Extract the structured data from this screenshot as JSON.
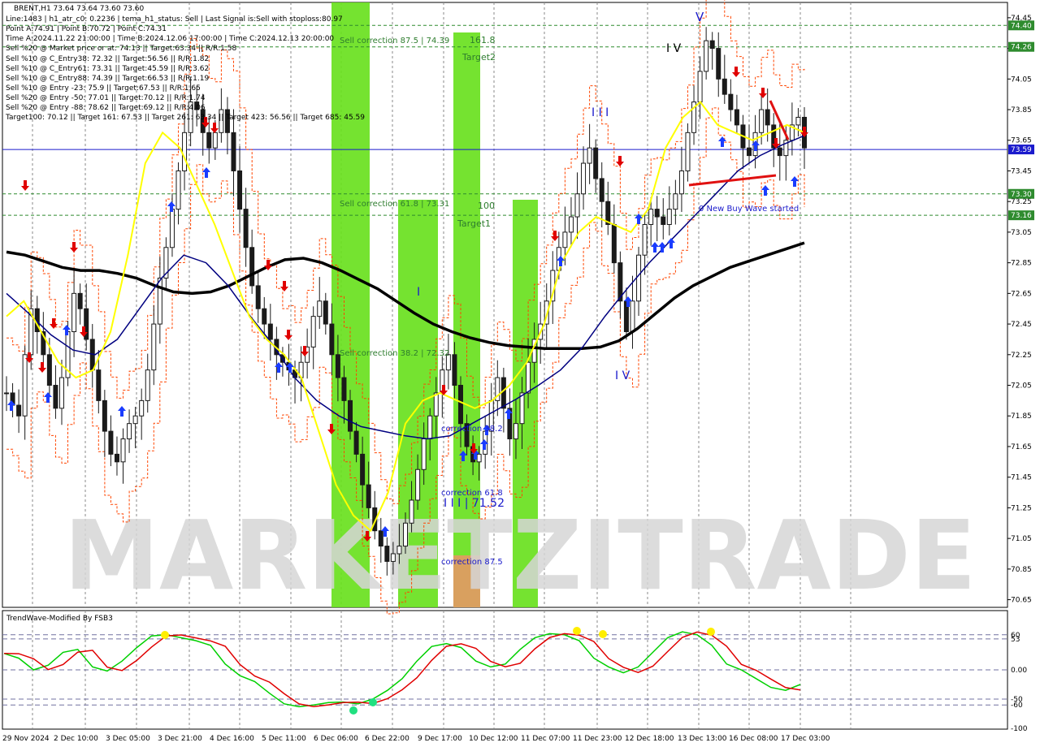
{
  "header": {
    "info_lines": [
      "BRENT,H1  73.64 73.64 73.60 73.60",
      "Line:1483  | h1_atr_c0: 0.2236  | tema_h1_status: Sell  | Last Signal is:Sell with stoploss:80.97",
      "Point A:74.91  | Point B:70.72  | Point C:74.31",
      "Time A:2024.11.22 21:00:00  | Time B:2024.12.06 17:00:00  | Time C:2024.12.13 20:00:00",
      "Sell %20 @ Market price or at: 74.13  || Target:63.34  || R/R:1.58",
      "Sell %10 @ C_Entry38: 72.32  || Target:56.56  || R/R:1.82",
      "Sell %10 @ C_Entry61: 73.31  || Target:45.59  || R/R:3.62",
      "Sell %10 @ C_Entry88: 74.39  || Target:66.53  || R/R:1.19",
      "Sell %10 @ Entry -23: 75.9  || Target:67.53  || R/R:1.65",
      "Sell %20 @ Entry -50: 77.01  || Target:70.12  || R/R:1.74",
      "Sell %20 @ Entry -88: 78.62  || Target:69.12  || R/R:4.06",
      "Target100: 70.12  || Target 161: 67.53  || Target 261: 63.34  || Target 423: 56.56  || Target 685: 45.59"
    ]
  },
  "colors": {
    "background": "#ffffff",
    "grid": "#8a8a8a",
    "candle_up": "#1a1a1a",
    "candle_down": "#1a1a1a",
    "ma_slow": "#000000",
    "ma_mid": "#000080",
    "ma_fast": "#ffff00",
    "envelope": "#ff4500",
    "green_zone": "#66e01a",
    "green_zone_dark": "#22b91c",
    "orange_zone": "#d9a05f",
    "price_line": "#1a1acc",
    "level_line": "#2e8b2e",
    "up_arrow": "#1a3cff",
    "down_arrow": "#e00000",
    "osc_green": "#00d000",
    "osc_red": "#e00000",
    "osc_dot_yellow": "#ffee00",
    "osc_dot_green": "#20e080",
    "price_label_green": "#2e8b2e",
    "price_label_blue": "#1a1acc"
  },
  "annotations": {
    "sell_corr_875": "Sell correction 87.5 | 74.39",
    "sell_corr_618": "Sell correction 61.8 | 73.31",
    "sell_corr_382": "Sell correction 38.2 | 72.32",
    "ext_1618": "161.8",
    "target2": "Target2",
    "ext_100": "100",
    "target1": "Target1",
    "corr_382": "correction 38.2",
    "corr_618": "correction 61.8",
    "corr_875": "correction 87.5",
    "wave_III_val": "I I I | 71.52",
    "new_buy_wave": "0 New Buy Wave started",
    "wave_I": "I",
    "wave_III_top": "I I I",
    "wave_IV_top": "I V",
    "wave_V": "V",
    "wave_IV_bottom": "I V",
    "watermark": "MARKETZITRADE"
  },
  "price_labels": [
    {
      "text": "74.40",
      "kind": "level",
      "value": 74.4
    },
    {
      "text": "74.26",
      "kind": "level",
      "value": 74.26
    },
    {
      "text": "73.59",
      "kind": "current",
      "value": 73.59
    },
    {
      "text": "73.30",
      "kind": "level",
      "value": 73.3
    },
    {
      "text": "73.16",
      "kind": "level",
      "value": 73.16
    }
  ],
  "oscillator": {
    "title": "TrendWave-Modified By FSB3",
    "y_ticks": [
      "60",
      "53",
      "0.00",
      "-50",
      "-60",
      "-100"
    ]
  },
  "chart_data": {
    "type": "candlestick",
    "symbol": "BRENT,H1",
    "ylim": [
      70.6,
      74.55
    ],
    "y_ticks": [
      "74.45",
      "74.25",
      "74.05",
      "73.85",
      "73.65",
      "73.45",
      "73.25",
      "73.05",
      "72.85",
      "72.65",
      "72.45",
      "72.25",
      "72.05",
      "71.85",
      "71.65",
      "71.45",
      "71.25",
      "71.05",
      "70.85",
      "70.65"
    ],
    "x_ticks": [
      "29 Nov 2024",
      "2 Dec 10:00",
      "3 Dec 05:00",
      "3 Dec 21:00",
      "4 Dec 16:00",
      "5 Dec 11:00",
      "6 Dec 06:00",
      "6 Dec 22:00",
      "9 Dec 17:00",
      "10 Dec 12:00",
      "11 Dec 07:00",
      "11 Dec 23:00",
      "12 Dec 18:00",
      "13 Dec 13:00",
      "16 Dec 08:00",
      "17 Dec 03:00"
    ],
    "closes": [
      72.0,
      71.92,
      71.85,
      72.25,
      72.55,
      72.4,
      72.25,
      72.05,
      71.9,
      72.1,
      72.4,
      72.65,
      72.55,
      72.35,
      72.15,
      71.95,
      71.75,
      71.6,
      71.55,
      71.7,
      71.8,
      71.85,
      71.95,
      72.15,
      72.45,
      72.75,
      72.95,
      73.2,
      73.45,
      73.7,
      73.9,
      73.85,
      73.7,
      73.6,
      73.7,
      73.85,
      73.7,
      73.45,
      73.2,
      72.95,
      72.7,
      72.55,
      72.45,
      72.35,
      72.25,
      72.2,
      72.15,
      72.1,
      72.2,
      72.3,
      72.5,
      72.6,
      72.45,
      72.25,
      72.1,
      71.95,
      71.75,
      71.6,
      71.4,
      71.25,
      71.1,
      71.0,
      70.9,
      70.95,
      71.0,
      71.15,
      71.3,
      71.5,
      71.7,
      71.85,
      72.0,
      72.15,
      72.25,
      72.05,
      71.8,
      71.65,
      71.55,
      71.6,
      71.75,
      71.95,
      72.1,
      71.9,
      71.7,
      71.8,
      72.0,
      72.2,
      72.35,
      72.45,
      72.6,
      72.8,
      72.95,
      73.05,
      73.15,
      73.3,
      73.5,
      73.6,
      73.4,
      73.25,
      73.1,
      72.85,
      72.6,
      72.4,
      72.6,
      72.9,
      73.1,
      73.2,
      73.15,
      73.1,
      73.2,
      73.3,
      73.45,
      73.7,
      73.9,
      74.1,
      74.3,
      74.25,
      74.05,
      73.95,
      73.85,
      73.75,
      73.6,
      73.55,
      73.7,
      73.85,
      73.75,
      73.6,
      73.55,
      73.65,
      73.75,
      73.8,
      73.6
    ],
    "series": [
      {
        "name": "",
        "role": "ma_slow",
        "values": [
          72.92,
          72.9,
          72.86,
          72.82,
          72.8,
          72.8,
          72.78,
          72.75,
          72.7,
          72.66,
          72.65,
          72.66,
          72.7,
          72.76,
          72.82,
          72.87,
          72.88,
          72.85,
          72.8,
          72.74,
          72.68,
          72.6,
          72.52,
          72.45,
          72.4,
          72.36,
          72.33,
          72.31,
          72.3,
          72.29,
          72.29,
          72.29,
          72.3,
          72.34,
          72.42,
          72.52,
          72.62,
          72.7,
          72.76,
          72.82,
          72.86,
          72.9,
          72.94,
          72.98
        ]
      },
      {
        "name": "",
        "role": "ma_mid",
        "values": [
          72.65,
          72.52,
          72.38,
          72.28,
          72.25,
          72.35,
          72.55,
          72.75,
          72.9,
          72.85,
          72.7,
          72.5,
          72.32,
          72.1,
          71.95,
          71.85,
          71.78,
          71.75,
          71.72,
          71.7,
          71.72,
          71.8,
          71.88,
          71.96,
          72.05,
          72.15,
          72.3,
          72.5,
          72.68,
          72.85,
          73.0,
          73.15,
          73.3,
          73.45,
          73.55,
          73.62,
          73.68
        ]
      },
      {
        "name": "",
        "role": "ma_fast",
        "values": [
          72.5,
          72.6,
          72.4,
          72.2,
          72.1,
          72.15,
          72.4,
          72.9,
          73.5,
          73.7,
          73.6,
          73.35,
          73.1,
          72.8,
          72.5,
          72.35,
          72.25,
          72.1,
          71.75,
          71.4,
          71.2,
          71.1,
          71.35,
          71.8,
          71.95,
          72.0,
          71.95,
          71.9,
          71.95,
          72.05,
          72.2,
          72.45,
          72.85,
          73.05,
          73.15,
          73.1,
          73.05,
          73.2,
          73.6,
          73.8,
          73.9,
          73.75,
          73.7,
          73.65,
          73.7,
          73.75,
          73.7
        ]
      }
    ],
    "fib_levels": [
      {
        "label": "Sell correction 87.5",
        "value": 74.39
      },
      {
        "label": "Sell correction 61.8",
        "value": 73.31
      },
      {
        "label": "Sell correction 38.2",
        "value": 72.32
      }
    ],
    "current_price": 73.59,
    "grid": true
  },
  "oscillator_data": {
    "ylim": [
      -100,
      100
    ],
    "levels": [
      60,
      53,
      0,
      -50,
      -60
    ],
    "green": [
      28,
      20,
      0,
      8,
      30,
      35,
      5,
      -2,
      15,
      38,
      58,
      60,
      55,
      50,
      42,
      10,
      -10,
      -20,
      -40,
      -58,
      -63,
      -60,
      -56,
      -55,
      -58,
      -50,
      -35,
      -15,
      15,
      40,
      45,
      38,
      15,
      5,
      10,
      35,
      55,
      62,
      60,
      50,
      20,
      5,
      -5,
      5,
      30,
      55,
      65,
      60,
      42,
      10,
      0,
      -15,
      -30,
      -35,
      -25
    ]
  }
}
